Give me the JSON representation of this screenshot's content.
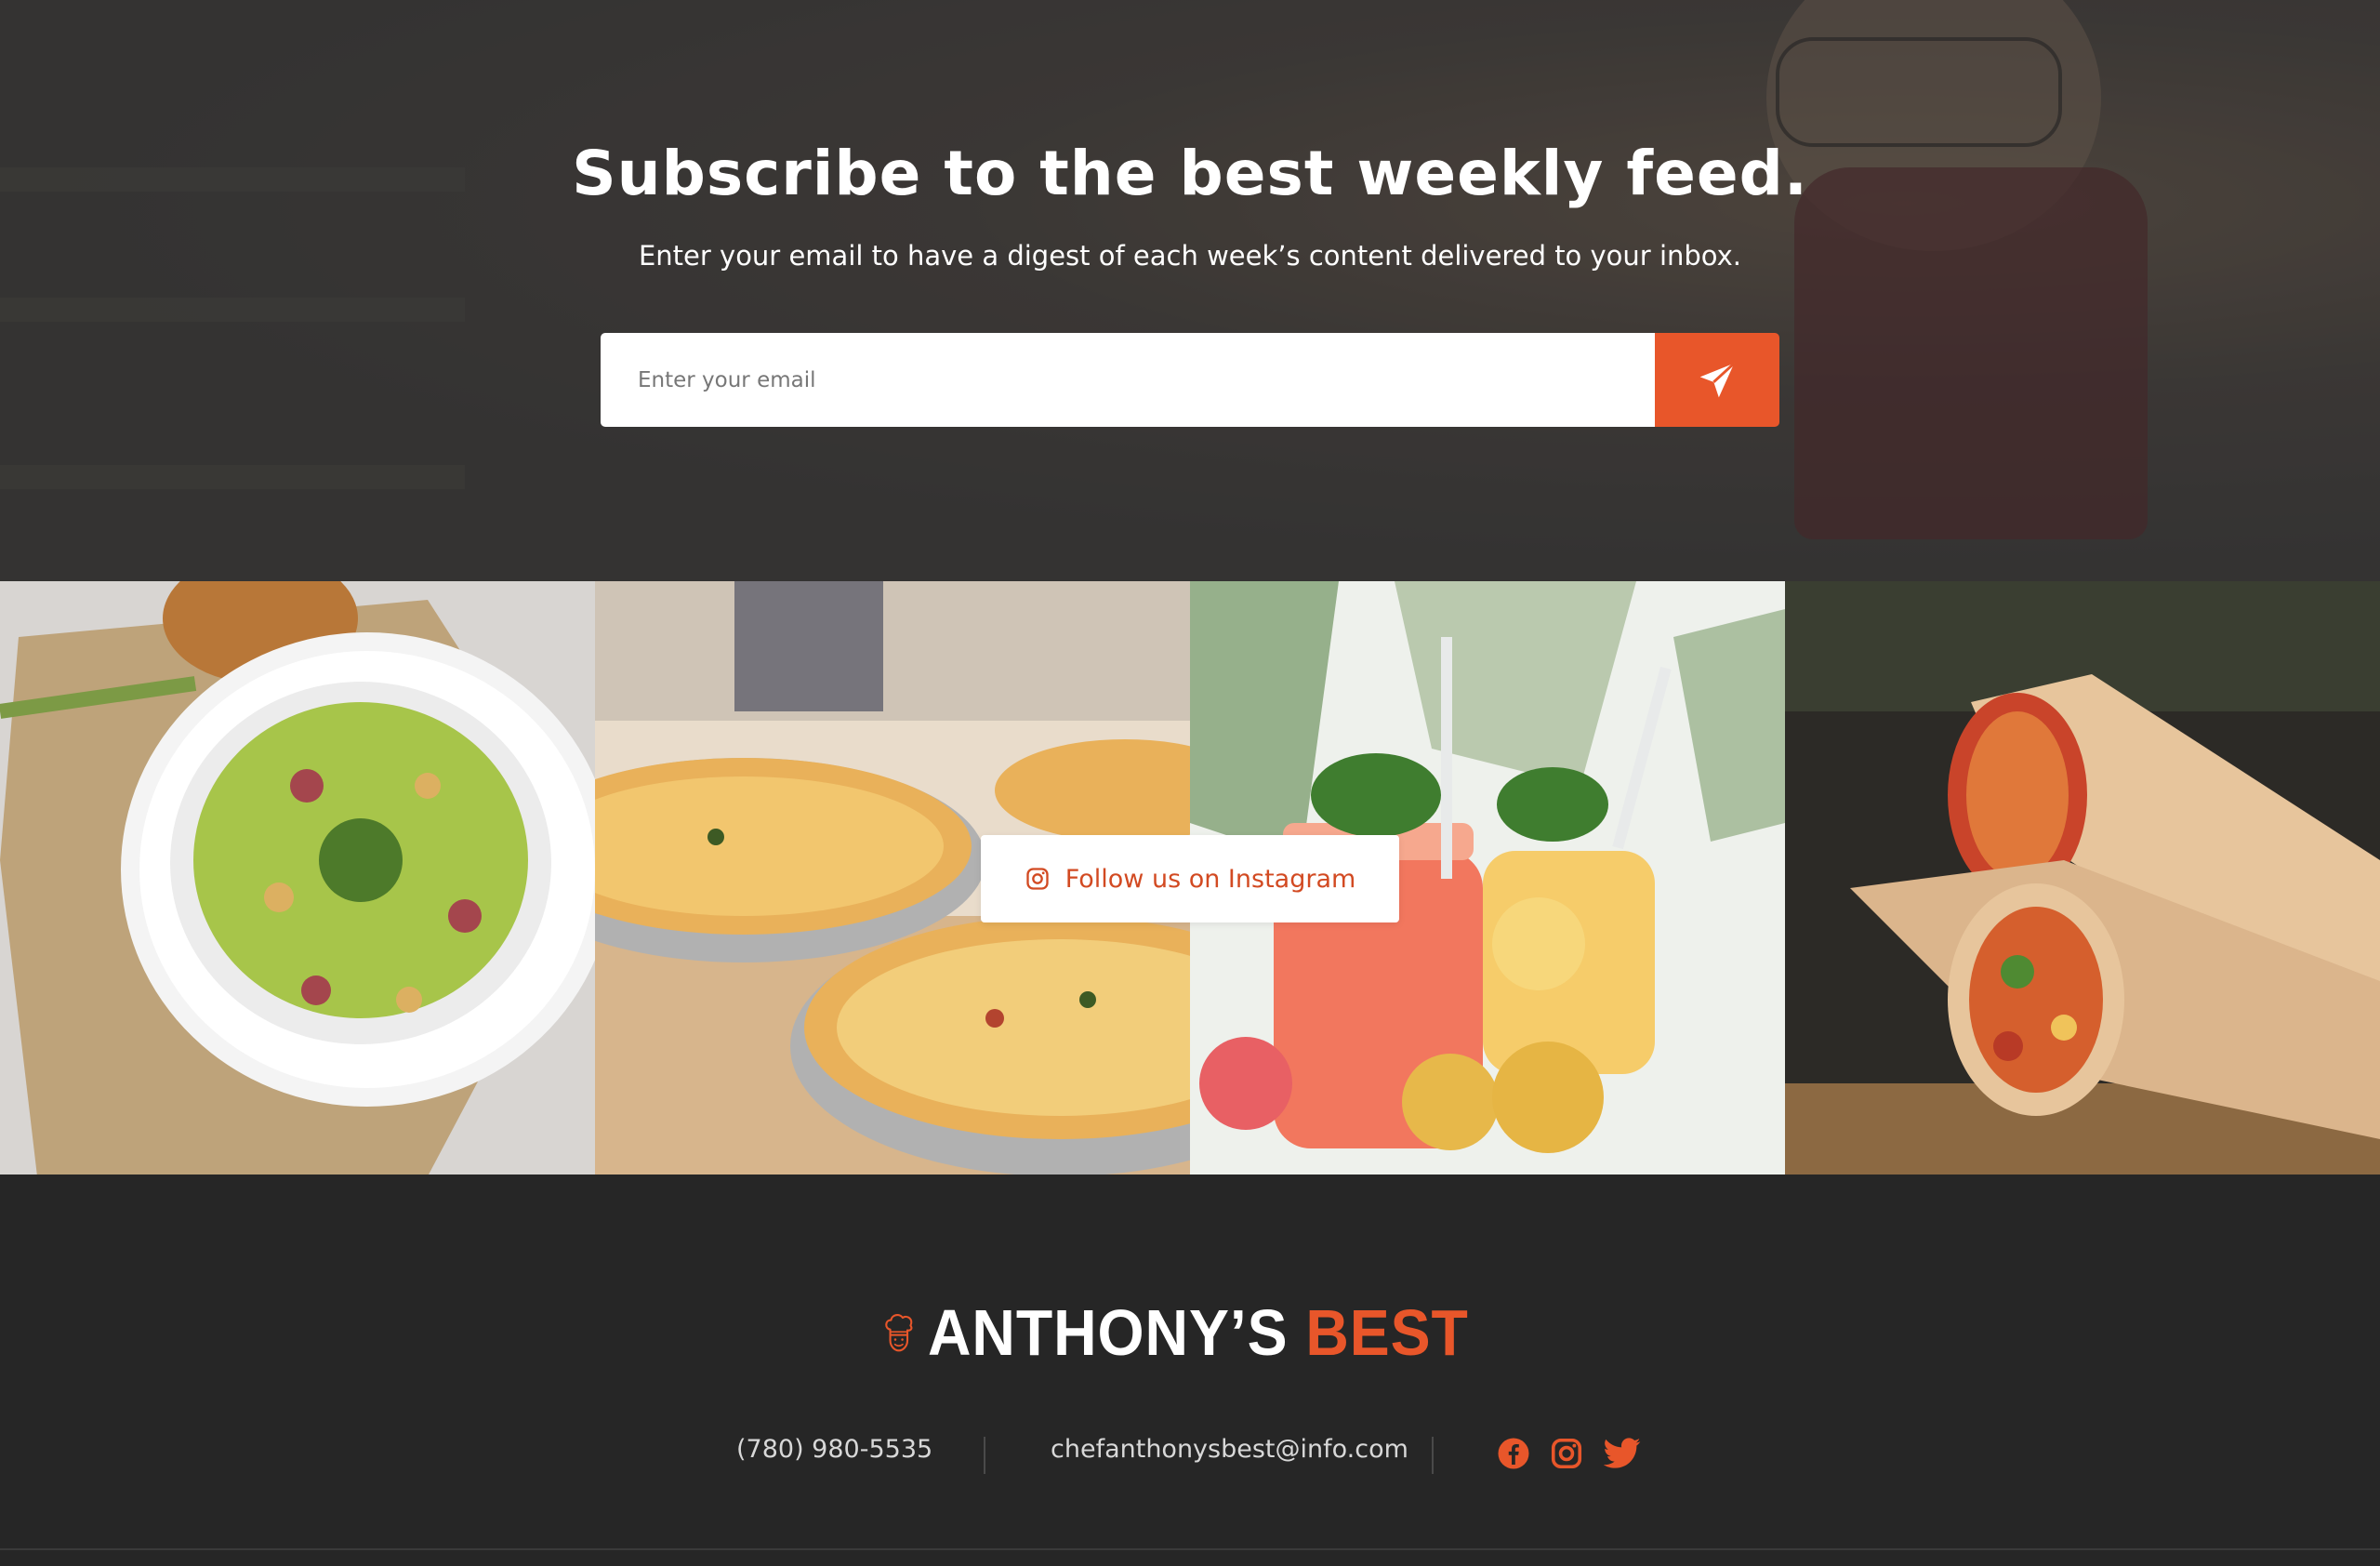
{
  "subscribe": {
    "title": "Subscribe to the best weekly feed.",
    "text": "Enter your email to have a digest of each week’s content delivered to your inbox.",
    "email_placeholder": "Enter your email",
    "send_icon": "send-icon"
  },
  "gallery": {
    "images": [
      "asparagus-soup-image",
      "quiche-image",
      "lemonade-image",
      "wrap-image"
    ],
    "instagram_label": "Follow us on Instagram",
    "instagram_icon": "instagram-icon"
  },
  "footer": {
    "brand_first": "ANTHONY’S",
    "brand_second": "BEST",
    "phone": "(780) 980-5535",
    "email": "chefanthonysbest@info.com",
    "social_icons": [
      "facebook-icon",
      "instagram-icon",
      "twitter-icon"
    ]
  },
  "colors": {
    "accent": "#e8562a",
    "footer_bg": "#262626",
    "text_light": "#ffffff"
  }
}
